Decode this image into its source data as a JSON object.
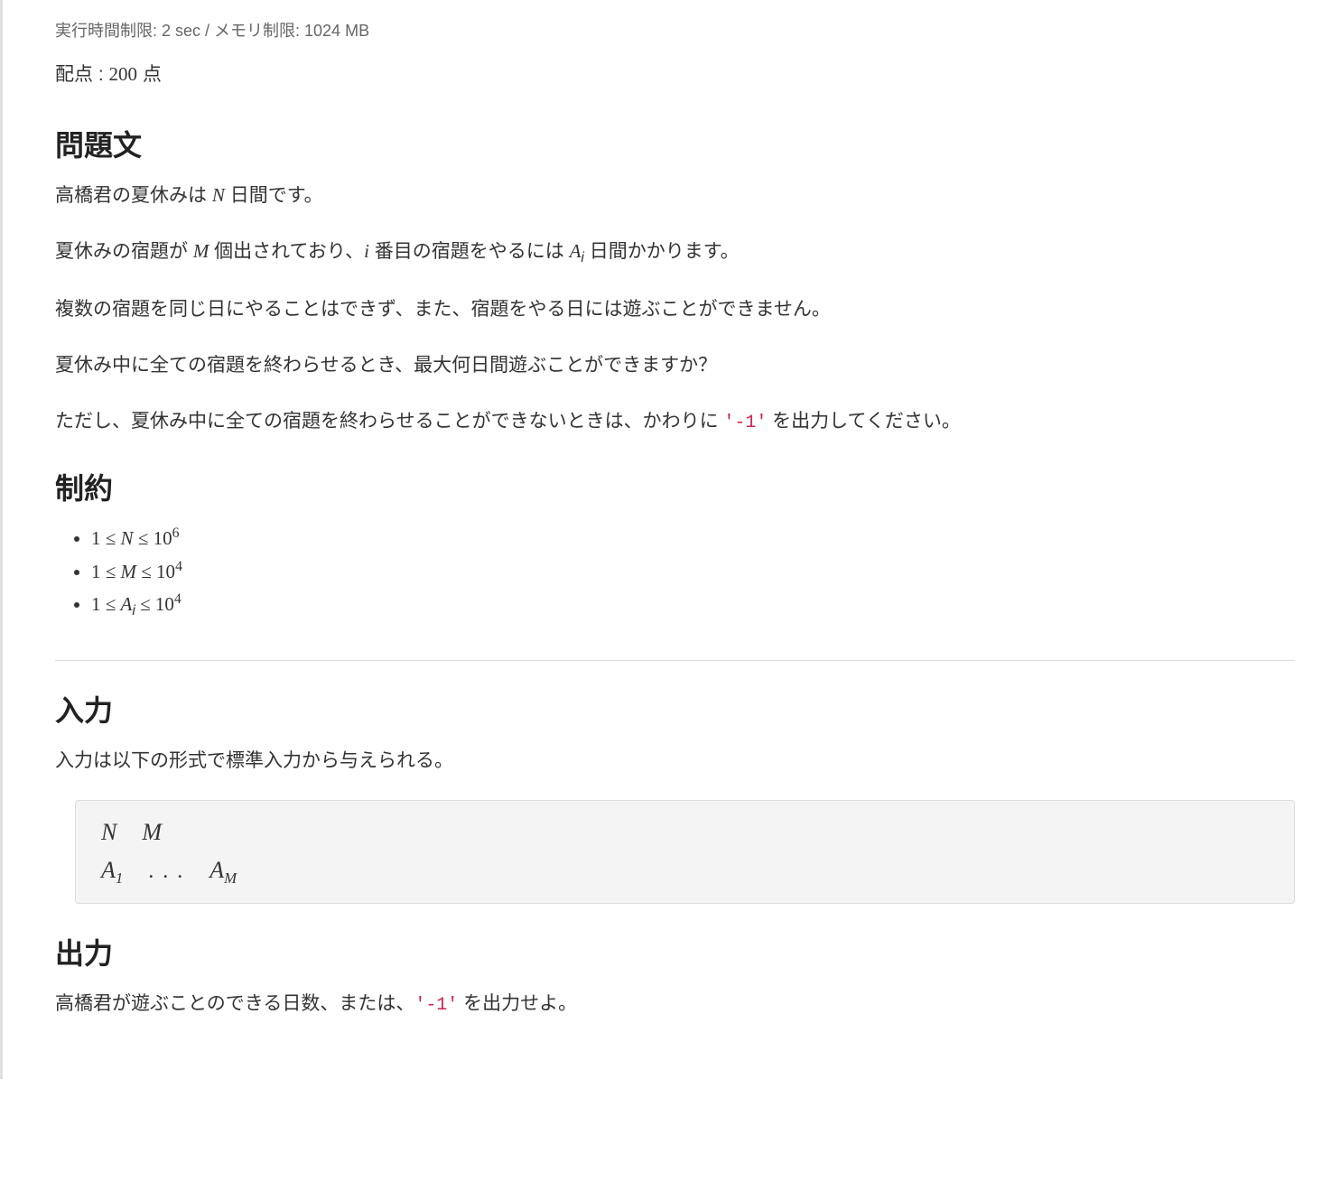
{
  "meta": {
    "limits": "実行時間制限: 2 sec / メモリ制限: 1024 MB",
    "score_prefix": "配点 : ",
    "score_value": "200",
    "score_suffix": " 点"
  },
  "problem": {
    "heading": "問題文",
    "p1_a": "高橋君の夏休みは ",
    "p1_N": "N",
    "p1_b": " 日間です。",
    "p2_a": "夏休みの宿題が ",
    "p2_M": "M",
    "p2_b": " 個出されており、",
    "p2_i": "i",
    "p2_c": " 番目の宿題をやるには ",
    "p2_Ai_A": "A",
    "p2_Ai_i": "i",
    "p2_d": " 日間かかります。",
    "p3": "複数の宿題を同じ日にやることはできず、また、宿題をやる日には遊ぶことができません。",
    "p4": "夏休み中に全ての宿題を終わらせるとき、最大何日間遊ぶことができますか？",
    "p5_a": "ただし、夏休み中に全ての宿題を終わらせることができないときは、かわりに ",
    "p5_code": "'-1'",
    "p5_b": " を出力してください。"
  },
  "constraints": {
    "heading": "制約",
    "c1_l": "1 ≤ ",
    "c1_v": "N",
    "c1_r": " ≤ 10",
    "c1_exp": "6",
    "c2_l": "1 ≤ ",
    "c2_v": "M",
    "c2_r": " ≤ 10",
    "c2_exp": "4",
    "c3_l": "1 ≤ ",
    "c3_v_A": "A",
    "c3_v_i": "i",
    "c3_r": " ≤ 10",
    "c3_exp": "4"
  },
  "input": {
    "heading": "入力",
    "desc": "入力は以下の形式で標準入力から与えられる。",
    "row1_a": "N",
    "row1_b": "M",
    "row2_a_A": "A",
    "row2_a_1": "1",
    "row2_dots": ". . .",
    "row2_b_A": "A",
    "row2_b_M": "M"
  },
  "output": {
    "heading": "出力",
    "p_a": "高橋君が遊ぶことのできる日数、または、",
    "p_code": "'-1'",
    "p_b": " を出力せよ。"
  }
}
